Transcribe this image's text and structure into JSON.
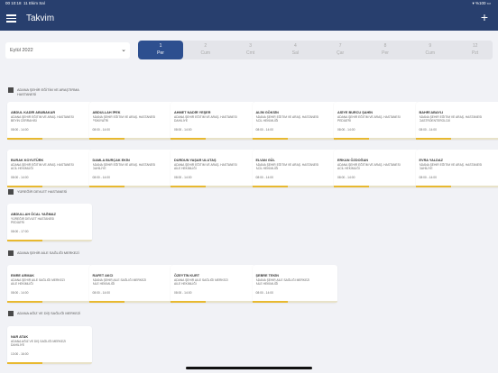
{
  "status": {
    "time": "00 10:18",
    "date": "11 Ekim Sal",
    "battery": "%100"
  },
  "header": {
    "title": "Takvim"
  },
  "month_select": {
    "value": "Eylül 2022"
  },
  "days": [
    {
      "num": "1",
      "name": "Per",
      "active": true
    },
    {
      "num": "2",
      "name": "Cum"
    },
    {
      "num": "3",
      "name": "Cmt"
    },
    {
      "num": "4",
      "name": "Sal"
    },
    {
      "num": "7",
      "name": "Çar"
    },
    {
      "num": "8",
      "name": "Per"
    },
    {
      "num": "9",
      "name": "Cum"
    },
    {
      "num": "12",
      "name": "Pzt"
    }
  ],
  "sections": [
    {
      "title": "ADANA ŞEHİR EĞİTİM VE ARAŞTIRMA HASTANESİ",
      "cards": [
        {
          "name": "ABDUL KADİR ABUBAKAR",
          "hosp": "ADANA ŞEHİR EĞİTİM VE ARAŞ. HASTANESİ",
          "dept": "BEYİN CERRAHİSİ",
          "time": "08:00 - 14:00"
        },
        {
          "name": "ABDULLAH İPEK",
          "hosp": "ADANA ŞEHİR EĞİTİM VE ARAŞ. HASTANESİ",
          "dept": "PSİKİYATRİ",
          "time": "08:00 - 14:00"
        },
        {
          "name": "AHMET NADİR YEŞER",
          "hosp": "ADANA ŞEHİR EĞİTİM VE ARAŞ. HASTANESİ",
          "dept": "DAHİLİYE",
          "time": "08:00 - 14:00"
        },
        {
          "name": "ALİM GÖKSİN",
          "hosp": "ADANA ŞEHİR EĞİTİM VE ARAŞ. HASTANESİ",
          "dept": "ACİL HEKİMLİĞİ",
          "time": "08:00 - 14:00"
        },
        {
          "name": "ASİYE BURCU ŞAHİN",
          "hosp": "ADANA ŞEHİR EĞİTİM VE ARAŞ. HASTANESİ",
          "dept": "PEDİATRİ",
          "time": "08:00 - 14:00"
        },
        {
          "name": "BAHRİ ABAYLI",
          "hosp": "ADANA ŞEHİR EĞİTİM VE ARAŞ. HASTANESİ",
          "dept": "GASTROENTEROLOJİ",
          "time": "08:00 - 14:00"
        },
        {
          "name": "BURAK KOYUTÜRK",
          "hosp": "ADANA ŞEHİR EĞİTİM VE ARAŞ. HASTANESİ",
          "dept": "ACİL HEKİMLİĞİ",
          "time": "08:00 - 14:00"
        },
        {
          "name": "DAMLA BURÇAK EKİN",
          "hosp": "ADANA ŞEHİR EĞİTİM VE ARAŞ. HASTANESİ",
          "dept": "DAHİLİYE",
          "time": "08:00 - 14:00"
        },
        {
          "name": "DURDUN YAŞAR ULUTAŞ",
          "hosp": "ADANA ŞEHİR EĞİTİM VE ARAŞ. HASTANESİ",
          "dept": "AİLE HEKİMLİĞİ",
          "time": "08:00 - 14:00"
        },
        {
          "name": "ELVAN GÜL",
          "hosp": "ADANA ŞEHİR EĞİTİM VE ARAŞ. HASTANESİ",
          "dept": "ACİL HEKİMLİĞİ",
          "time": "08:00 - 14:00"
        },
        {
          "name": "ERKAN ÖZDOĞAN",
          "hosp": "ADANA ŞEHİR EĞİTİM VE ARAŞ. HASTANESİ",
          "dept": "ACİL HEKİMLİĞİ",
          "time": "08:00 - 14:00"
        },
        {
          "name": "EVRA YALDAZ",
          "hosp": "ADANA ŞEHİR EĞİTİM VE ARAŞ. HASTANESİ",
          "dept": "DAHİLİYE",
          "time": "08:00 - 14:00"
        }
      ]
    },
    {
      "title": "YÜREĞİR DEVLET HASTANESİ",
      "cards": [
        {
          "name": "ABDULLAH ÖCAL YAĞMAZ",
          "hosp": "YÜREĞİR DEVLET HASTANESİ",
          "dept": "PEDİATRİ",
          "time": "08:00 - 17:00"
        }
      ]
    },
    {
      "title": "ADANA ŞEHİR AİLE SAĞLIĞI MERKEZİ",
      "cards": [
        {
          "name": "EMRE ARMAK",
          "hosp": "ADANA ŞEHİR AİLE SAĞLIĞI MERKEZİ",
          "dept": "AİLE HEKİMLİĞİ",
          "time": "08:00 - 14:00"
        },
        {
          "name": "RAFET AKCI",
          "hosp": "ADANA ŞEHİR AİLE SAĞLIĞI MERKEZİ",
          "dept": "AİLE HEKİMLİĞİ",
          "time": "08:00 - 14:00"
        },
        {
          "name": "ÖZEYTİN KURT",
          "hosp": "ADANA ŞEHİR AİLE SAĞLIĞI MERKEZİ",
          "dept": "AİLE HEKİMLİĞİ",
          "time": "08:00 - 14:00"
        },
        {
          "name": "ŞEBRE TEKİN",
          "hosp": "ADANA ŞEHİR AİLE SAĞLIĞI MERKEZİ",
          "dept": "AİLE HEKİMLİĞİ",
          "time": "08:00 - 14:00"
        }
      ]
    },
    {
      "title": "ADANA AĞIZ VE DİŞ SAĞLIĞI MERKEZİ",
      "cards": [
        {
          "name": "NAR ATAK",
          "hosp": "ADANA AĞIZ VE DİŞ SAĞLIĞI MERKEZİ",
          "dept": "DAHİLİYE",
          "time": "13:00 - 16:00"
        }
      ]
    }
  ]
}
